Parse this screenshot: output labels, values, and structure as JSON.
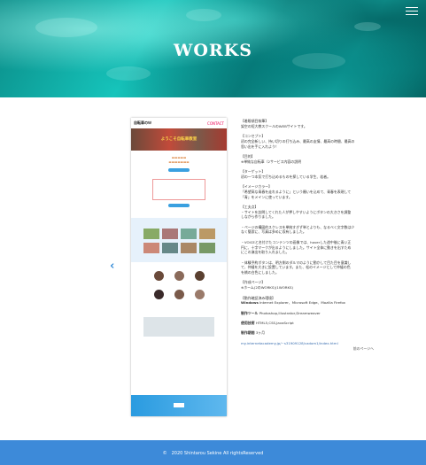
{
  "hero": {
    "title": "WORKS"
  },
  "nav": {
    "menu_icon": "hamburger-icon"
  },
  "mockup": {
    "logo": "自転車のＷ",
    "logo_right": "CONTACT",
    "hero_text": "ようこそ自転車教室",
    "arrow_left": "‹",
    "arrow_right": "›"
  },
  "info": {
    "lines": [
      "【着眼項目執筆】",
      "架空の短大教スクールのWEBサイトです。",
      "",
      "【コンセプト】",
      "初の完全新しい、持い切りの打ち込み、最高の友情、最高の時間、最高の",
      "思い出を手に入れよう！",
      "",
      "【目的】",
      "※単純な自転車（2サービス内容の説明",
      "",
      "【ターゲット】",
      "初の一つ本気で打ち込めるものを探している学生、若者。",
      "",
      "【イメージカラー】",
      "「希望高な青春を走れるように」という願いを込めて、青春を表現して",
      "「青」をメインに使っています。",
      "",
      "【工夫点】",
      "・サイトを訪問してくれた人が押しやすいようにボタンの大きさを調整",
      "しながら作りました。",
      "",
      "・ページの構図的スクレスを単純すぎず単とよりも、なるべく文字数は少",
      "なく簡潔に、写真は多めに収有しました。",
      "",
      "・VOICEと名付けたコンテンツの画像では、hoverした途中後に青い正",
      "円に、十字マークが出るようにしました。サイト全体に動きを出すため",
      "にこの演出を取り入れました。",
      "",
      "・体験予約ボタンは、明方側のダルマのように動かして目た目を意識し",
      "て、仲縫を大きに設置しています。また、松のイメージとして仲縫の色",
      "を橋の白色にしました。"
    ],
    "page_label": "【作成ページ】",
    "page_value": "※ホーム(2のWORKS)(1WORKS)",
    "env_label": "【動作確認済み環境】",
    "env_browsers_label": "Windows",
    "env_browsers": "Internet Explorer、Microsoft Edge、Mozilla Firefox",
    "tools_label": "制作ツール",
    "tools": "Photoshop,Illustrator,Dreamweaver",
    "lang_label": "使用技術",
    "lang": "HTML5,CSS,JavaScript",
    "period_label": "制作期間",
    "period": "3ヶ月",
    "url": "my.internetacademy.jp/~s31909128/cadom1/index.html",
    "back": "前のページへ"
  },
  "footer": {
    "copyright": "©　2020 Shintarou Sekine All rightsReserved"
  }
}
